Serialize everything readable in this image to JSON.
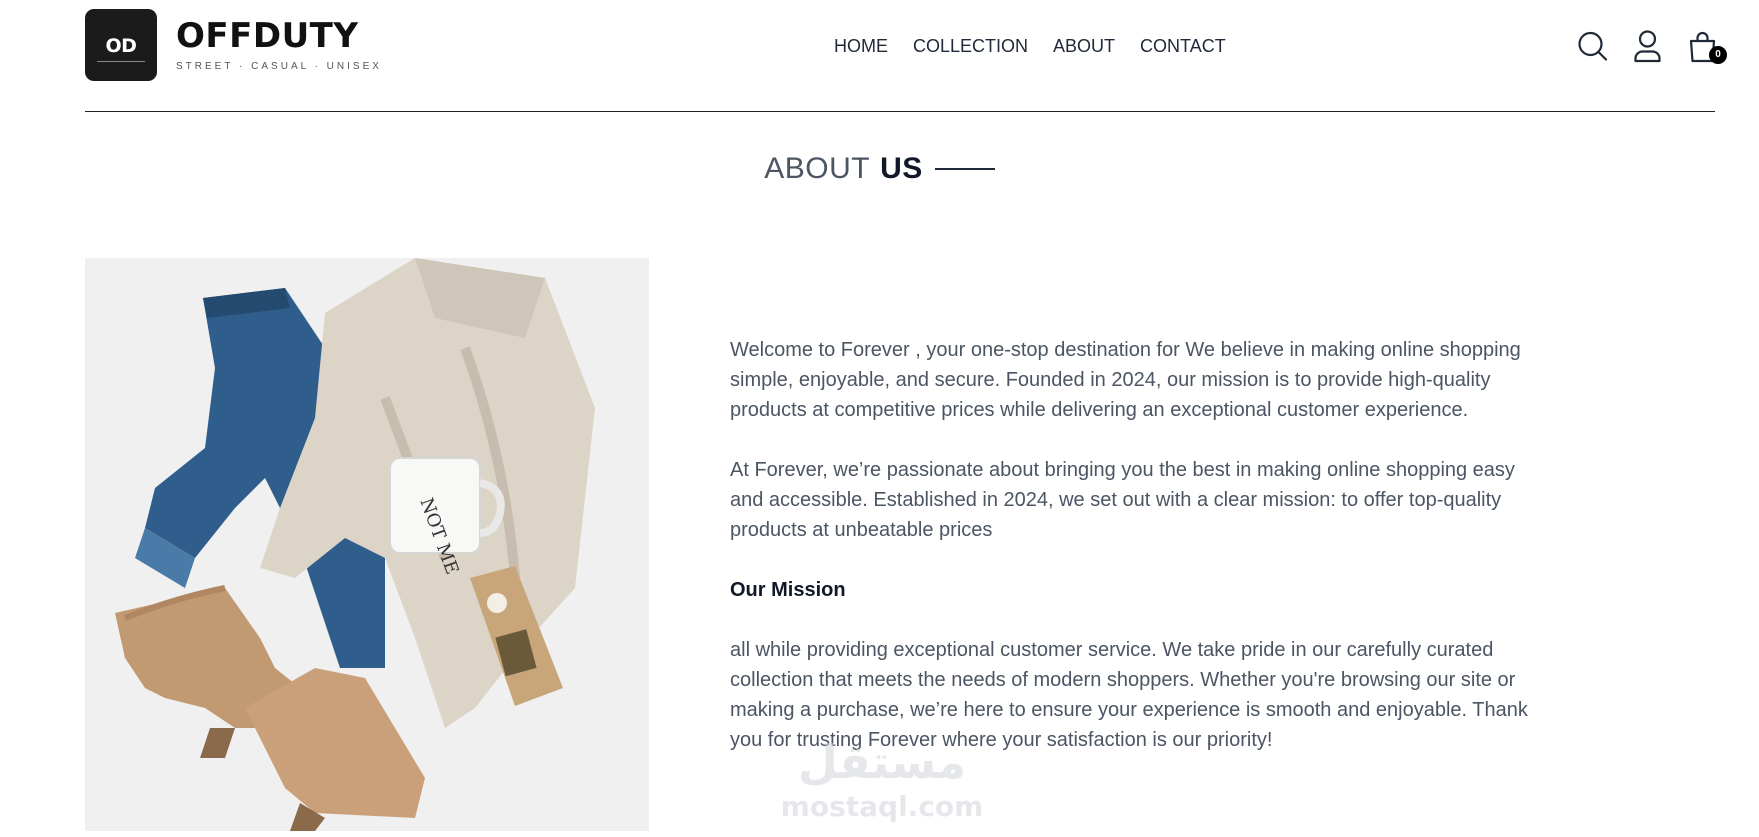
{
  "header": {
    "logo_mark": "OD",
    "brand_name": "OFFDUTY",
    "tagline": "STREET · CASUAL · UNISEX",
    "nav": [
      {
        "label": "HOME"
      },
      {
        "label": "COLLECTION"
      },
      {
        "label": "ABOUT"
      },
      {
        "label": "CONTACT"
      }
    ],
    "icons": [
      "search-icon",
      "user-icon",
      "shopping-bag-icon"
    ],
    "cart_count": "0"
  },
  "title": {
    "light": "ABOUT",
    "bold": "US"
  },
  "content": {
    "paragraph_1": "Welcome to Forever , your one-stop destination for We believe in making online shopping simple, enjoyable, and secure. Founded in 2024, our mission is to provide high-quality products at competitive prices while delivering an exceptional customer experience.",
    "paragraph_2": "At Forever, we’re passionate about bringing you the best in making online shopping easy and accessible. Established in 2024, we set out with a clear mission: to offer top-quality products at unbeatable prices",
    "mission_title": "Our Mission",
    "mission_text": "all while providing exceptional customer service. We take pride in our carefully curated collection that meets the needs of modern shoppers. Whether you're browsing our site or making a purchase, we’re here to ensure your experience is smooth and enjoyable. Thank you for trusting Forever where your satisfaction is our priority!"
  },
  "watermark": {
    "arabic": "مستقل",
    "latin": "mostaql.com"
  },
  "colors": {
    "text_primary": "#111827",
    "text_body": "#4b5563",
    "logo_bg": "#1b1b1b"
  }
}
